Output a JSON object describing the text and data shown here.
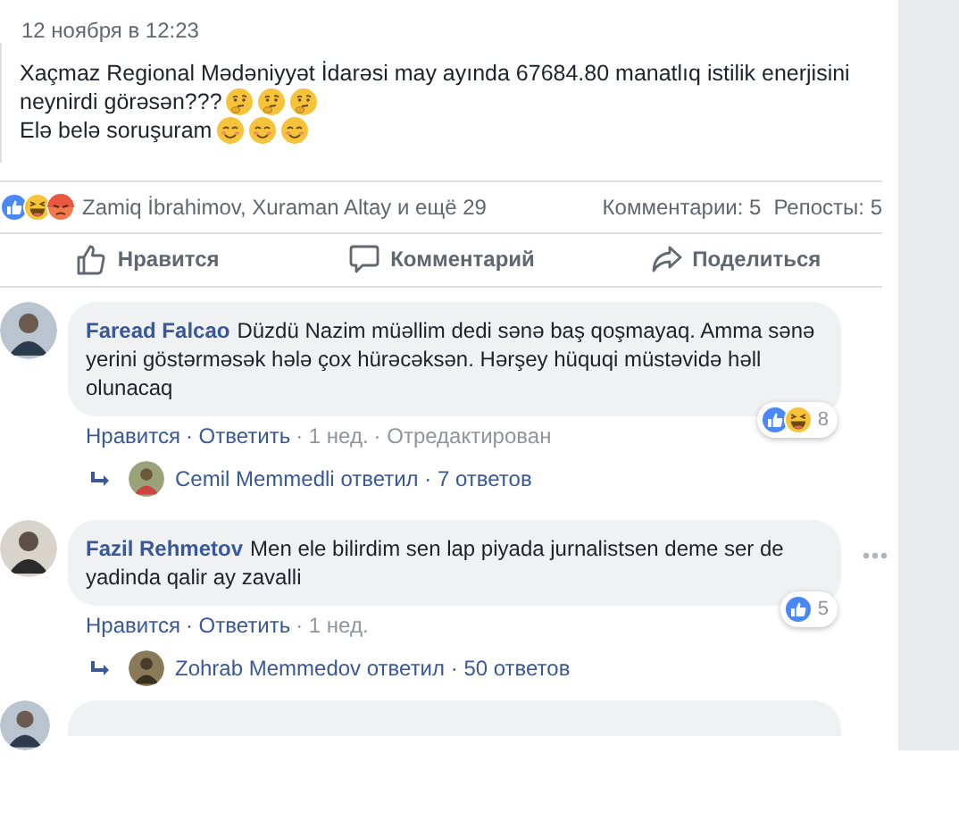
{
  "post": {
    "date": "12 ноября в 12:23",
    "lines": [
      {
        "text": "Xaçmaz Regional Mədəniyyət İdarəsi may ayında 67684.80 manatlıq istilik enerjisini"
      },
      {
        "text": "neynirdi görəsən???",
        "emojis": [
          {
            "kind": "thinking"
          },
          {
            "kind": "thinking"
          },
          {
            "kind": "thinking"
          }
        ]
      },
      {
        "text": "Elə belə soruşuram",
        "emojis": [
          {
            "kind": "smile"
          },
          {
            "kind": "smile"
          },
          {
            "kind": "smile"
          }
        ]
      }
    ],
    "reactions": [
      {
        "kind": "like"
      },
      {
        "kind": "haha"
      },
      {
        "kind": "angry"
      }
    ],
    "reactors": "Zamiq İbrahimov, Xuraman Altay и ещё 29",
    "comments_count": "Комментарии: 5",
    "shares_count": "Репосты: 5"
  },
  "actions": [
    {
      "kind": "like",
      "label": "Нравится"
    },
    {
      "kind": "comment",
      "label": "Комментарий"
    },
    {
      "kind": "share",
      "label": "Поделиться"
    }
  ],
  "comments": [
    {
      "author": "Faread Falcao",
      "text": "Düzdü Nazim müəllim dedi sənə baş qoşmayaq. Amma sənə yerini göstərməsək hələ çox hürəcəksən. Hərşey hüquqi müstəvidə həll olunacaq",
      "reactions": [
        {
          "kind": "like"
        },
        {
          "kind": "haha"
        }
      ],
      "reaction_count": "8",
      "meta": [
        "Нравится",
        "· Ответить",
        "· 1 нед.",
        "· Отредактирован"
      ],
      "reply_author": "Cemil Memmedli",
      "reply_verb": "ответил",
      "reply_count": "· 7 ответов",
      "menu": false
    },
    {
      "author": "Fazil Rehmetov",
      "text": "Men ele bilirdim sen lap piyada jurnalistsen deme ser de yadinda qalir ay zavalli",
      "reactions": [
        {
          "kind": "like"
        }
      ],
      "reaction_count": "5",
      "meta": [
        "Нравится",
        "· Ответить",
        "· 1 нед."
      ],
      "reply_author": "Zohrab Memmedov",
      "reply_verb": "ответил",
      "reply_count": "· 50 ответов",
      "menu": true
    }
  ]
}
